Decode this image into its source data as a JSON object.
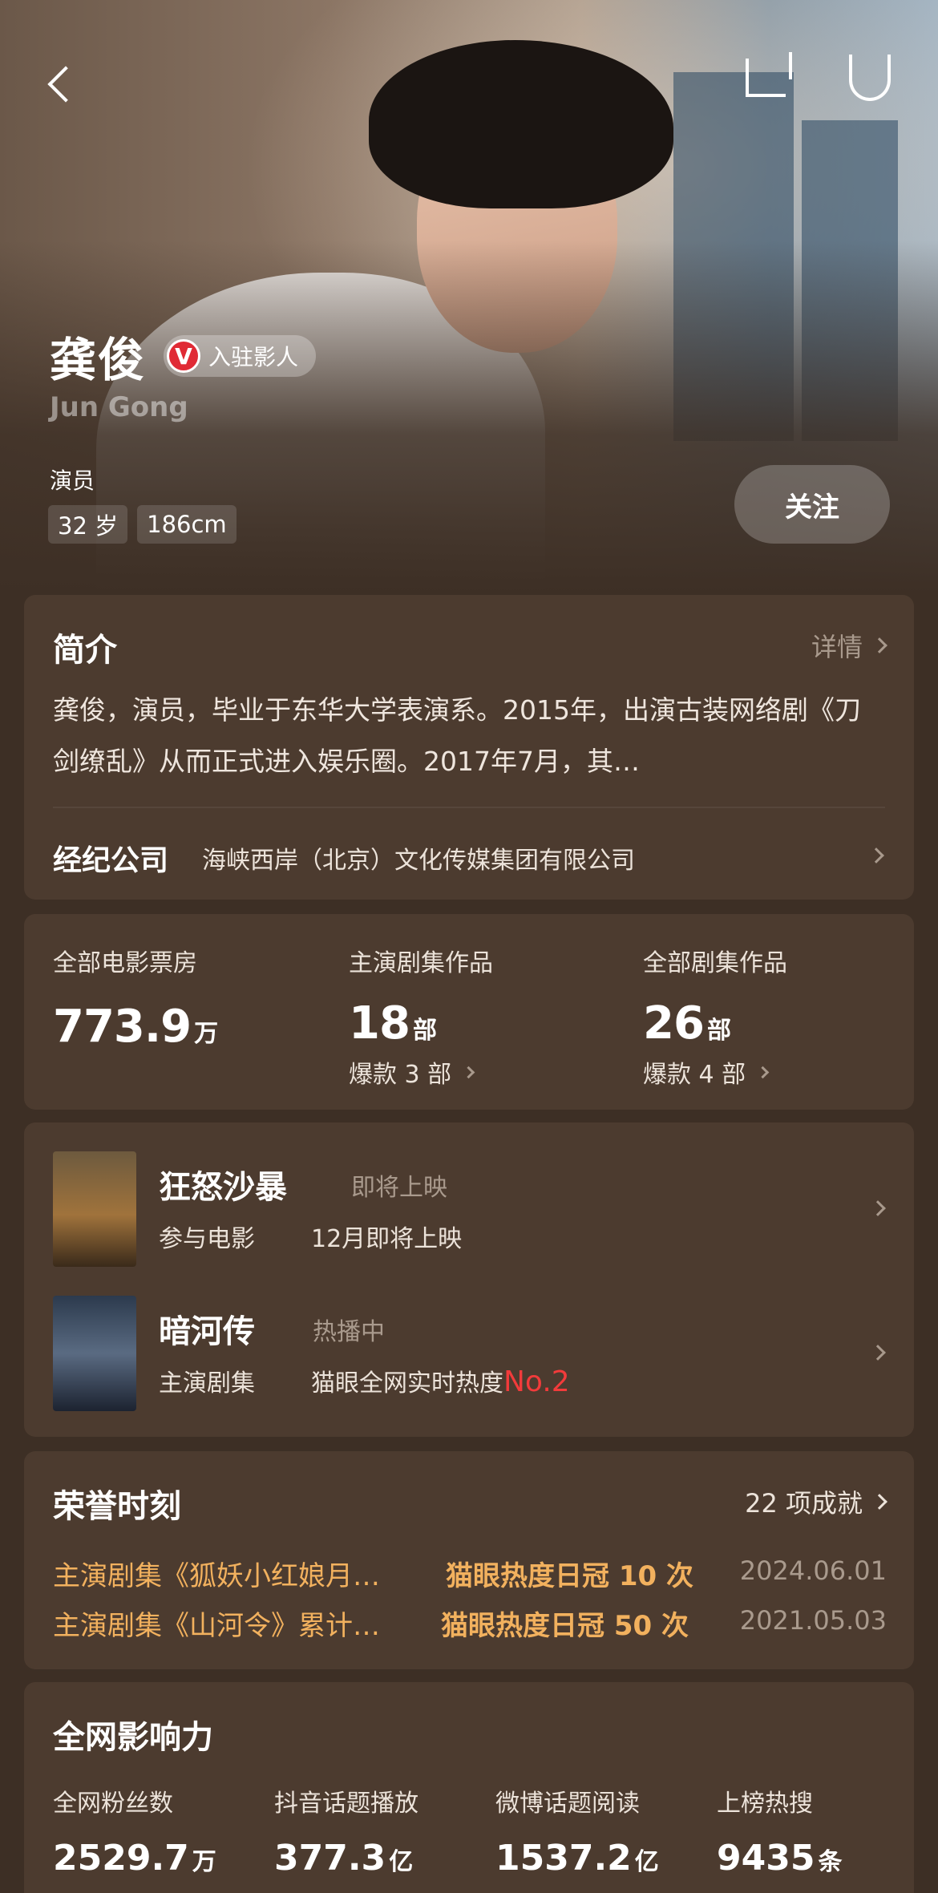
{
  "header": {
    "name": "龚俊",
    "badge_v": "V",
    "badge_label": "入驻影人",
    "english_name": "Jun Gong",
    "role": "演员",
    "tags": [
      "32 岁",
      "186cm"
    ],
    "follow_label": "关注"
  },
  "intro": {
    "title": "简介",
    "more_label": "详情",
    "bio": "龚俊，演员，毕业于东华大学表演系。2015年，出演古装网络剧《刀剑缭乱》从而正式进入娱乐圈。2017年7月，其…",
    "agency_label": "经纪公司",
    "agency_value": "海峡西岸（北京）文化传媒集团有限公司"
  },
  "stats": [
    {
      "label": "全部电影票房",
      "value": "773.9",
      "unit": "万",
      "sub": ""
    },
    {
      "label": "主演剧集作品",
      "value": "18",
      "unit": "部",
      "sub": "爆款 3 部"
    },
    {
      "label": "全部剧集作品",
      "value": "26",
      "unit": "部",
      "sub": "爆款 4 部"
    }
  ],
  "works": [
    {
      "title": "狂怒沙暴",
      "status": "即将上映",
      "category": "参与电影",
      "detail": "12月即将上映",
      "rank": ""
    },
    {
      "title": "暗河传",
      "status": "热播中",
      "category": "主演剧集",
      "detail": "猫眼全网实时热度",
      "rank": "No.2"
    }
  ],
  "honors": {
    "title": "荣誉时刻",
    "count_label": "22 项成就",
    "items": [
      {
        "text": "主演剧集《狐妖小红娘月…",
        "badge": "猫眼热度日冠 10 次",
        "date": "2024.06.01"
      },
      {
        "text": "主演剧集《山河令》累计…",
        "badge": "猫眼热度日冠 50 次",
        "date": "2021.05.03"
      }
    ]
  },
  "influence": {
    "title": "全网影响力",
    "items": [
      {
        "label": "全网粉丝数",
        "value": "2529.7",
        "unit": "万"
      },
      {
        "label": "抖音话题播放",
        "value": "377.3",
        "unit": "亿"
      },
      {
        "label": "微博话题阅读",
        "value": "1537.2",
        "unit": "亿"
      },
      {
        "label": "上榜热搜",
        "value": "9435",
        "unit": "条"
      }
    ]
  },
  "colors": {
    "background": "#3d2f25",
    "card": "#4c3b2f",
    "accent_gold": "#f2b15e",
    "rank_red": "#f23b3b",
    "badge_red": "#e02a35"
  }
}
